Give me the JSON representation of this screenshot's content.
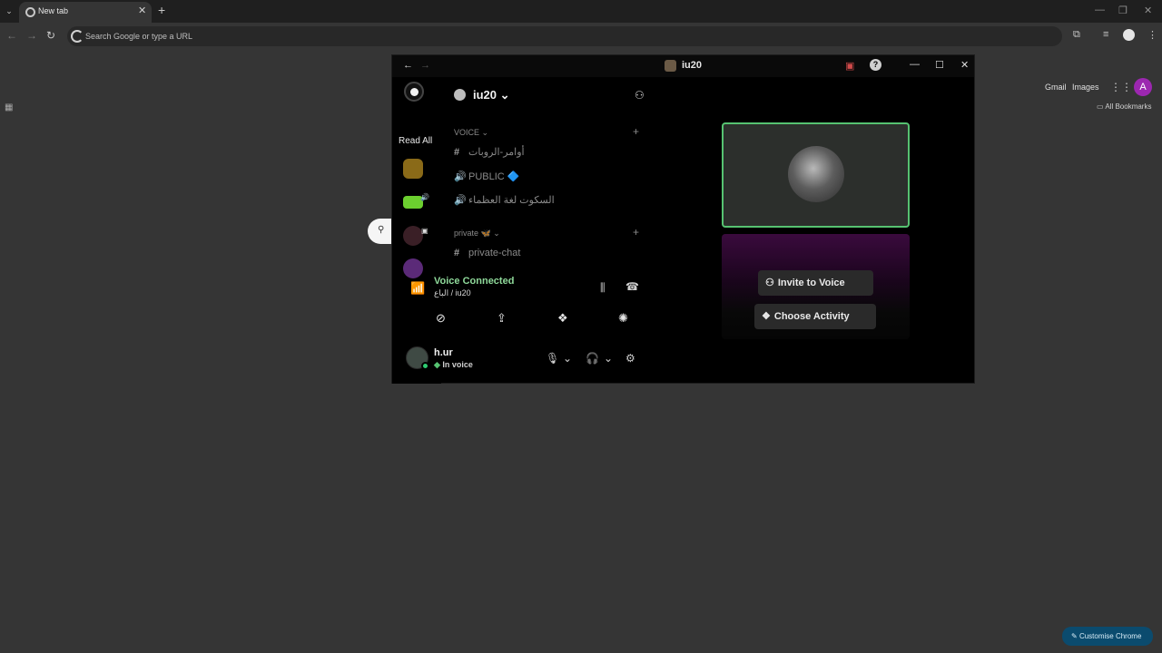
{
  "browser": {
    "tab_title": "New tab",
    "omnibox_placeholder": "Search Google or type a URL",
    "all_bookmarks": "All Bookmarks",
    "ntp_links": [
      "Gmail",
      "Images"
    ],
    "profile_initial": "A",
    "customise_label": "Customise Chrome"
  },
  "discord": {
    "window_title": "iu20",
    "server_name": "iu20",
    "read_all": "Read All",
    "categories": [
      {
        "label": "VOICE"
      },
      {
        "label": "private 🦋"
      }
    ],
    "channels": [
      {
        "type": "text",
        "name": "أوامر-الروبات"
      },
      {
        "type": "voice",
        "name": "PUBLIC 🔷"
      },
      {
        "type": "voice",
        "name": "السكوت لغة العظماء"
      },
      {
        "type": "text",
        "name": "private-chat"
      }
    ],
    "voice": {
      "status": "Voice Connected",
      "detail": "الباع / iu20"
    },
    "user": {
      "name": "h.ur",
      "status": "In voice"
    },
    "tile_buttons": {
      "invite": "Invite to Voice",
      "activity": "Choose Activity"
    },
    "colors": {
      "voice_green": "#8fd99a",
      "speaking_border": "#56c271",
      "activity_purple": "#3a0a3d"
    }
  }
}
